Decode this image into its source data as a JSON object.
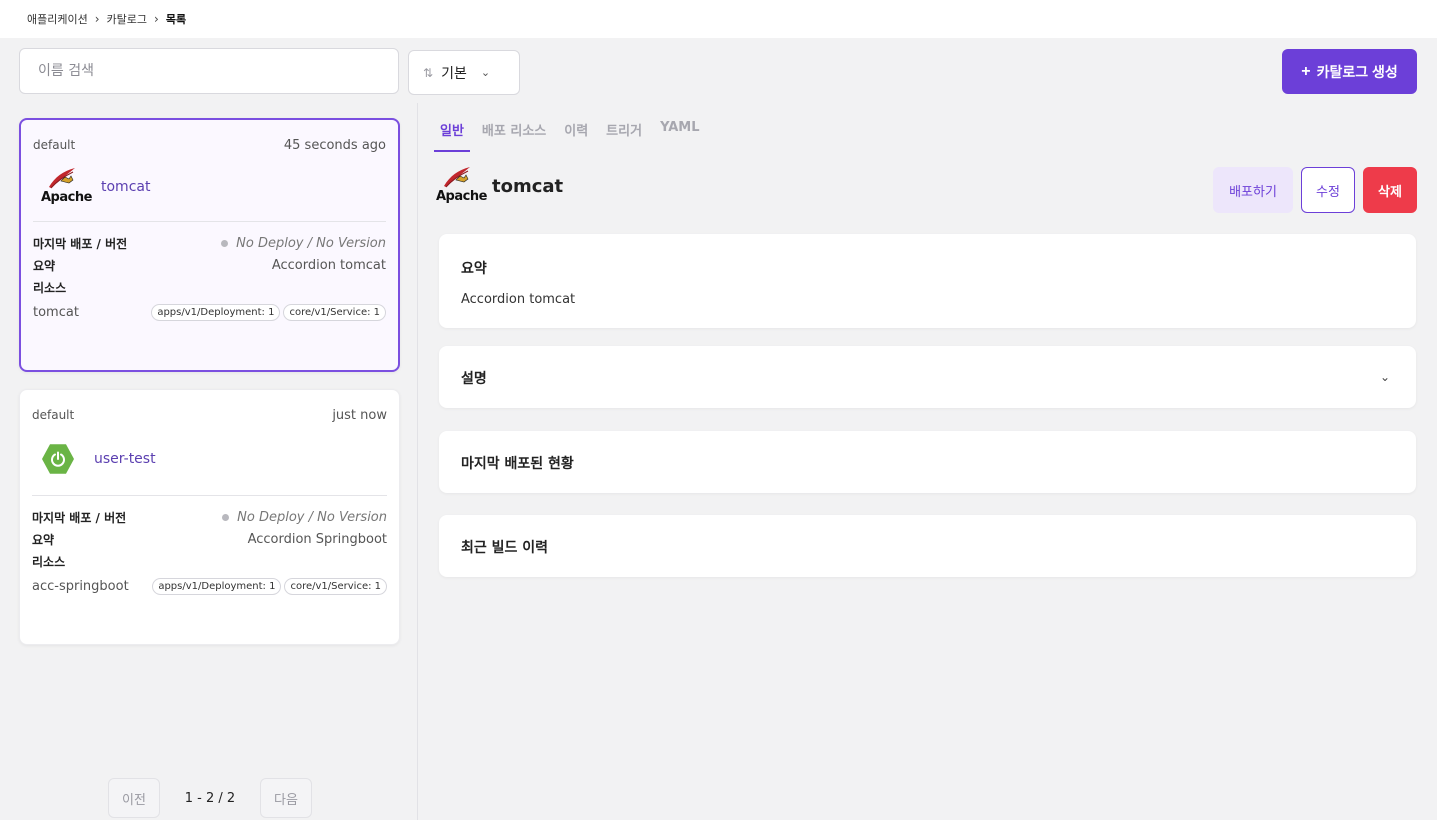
{
  "breadcrumb": {
    "items": [
      "애플리케이션",
      "카탈로그"
    ],
    "current": "목록",
    "separator": "›"
  },
  "toolbar": {
    "search_placeholder": "이름 검색",
    "sort_label": "기본",
    "create_label": "카탈로그 생성"
  },
  "list": {
    "cards": [
      {
        "namespace": "default",
        "time": "45 seconds ago",
        "name": "tomcat",
        "icon": "apache-tomcat-logo",
        "last_deploy_label": "마지막 배포 / 버전",
        "last_deploy_value": "No Deploy / No Version",
        "summary_label": "요약",
        "summary_value": "Accordion tomcat",
        "resources_label": "리소스",
        "resource_name": "tomcat",
        "chips": [
          "apps/v1/Deployment: 1",
          "core/v1/Service: 1"
        ]
      },
      {
        "namespace": "default",
        "time": "just now",
        "name": "user-test",
        "icon": "spring-boot-logo",
        "last_deploy_label": "마지막 배포 / 버전",
        "last_deploy_value": "No Deploy / No Version",
        "summary_label": "요약",
        "summary_value": "Accordion Springboot",
        "resources_label": "리소스",
        "resource_name": "acc-springboot",
        "chips": [
          "apps/v1/Deployment: 1",
          "core/v1/Service: 1"
        ]
      }
    ],
    "pager": {
      "prev": "이전",
      "info": "1 - 2 / 2",
      "next": "다음"
    }
  },
  "detail": {
    "tabs": [
      "일반",
      "배포 리소스",
      "이력",
      "트리거",
      "YAML"
    ],
    "active_tab": "일반",
    "title": "tomcat",
    "deploy_label": "배포하기",
    "edit_label": "수정",
    "delete_label": "삭제",
    "sections": {
      "summary_title": "요약",
      "summary_body": "Accordion tomcat",
      "description_title": "설명",
      "last_deploy_title": "마지막 배포된 현황",
      "build_history_title": "최근 빌드 이력"
    }
  },
  "colors": {
    "accent": "#6c3fd8",
    "danger": "#ee3b4a",
    "selected_border": "#7b4fe0",
    "spring_green": "#6ab445"
  }
}
